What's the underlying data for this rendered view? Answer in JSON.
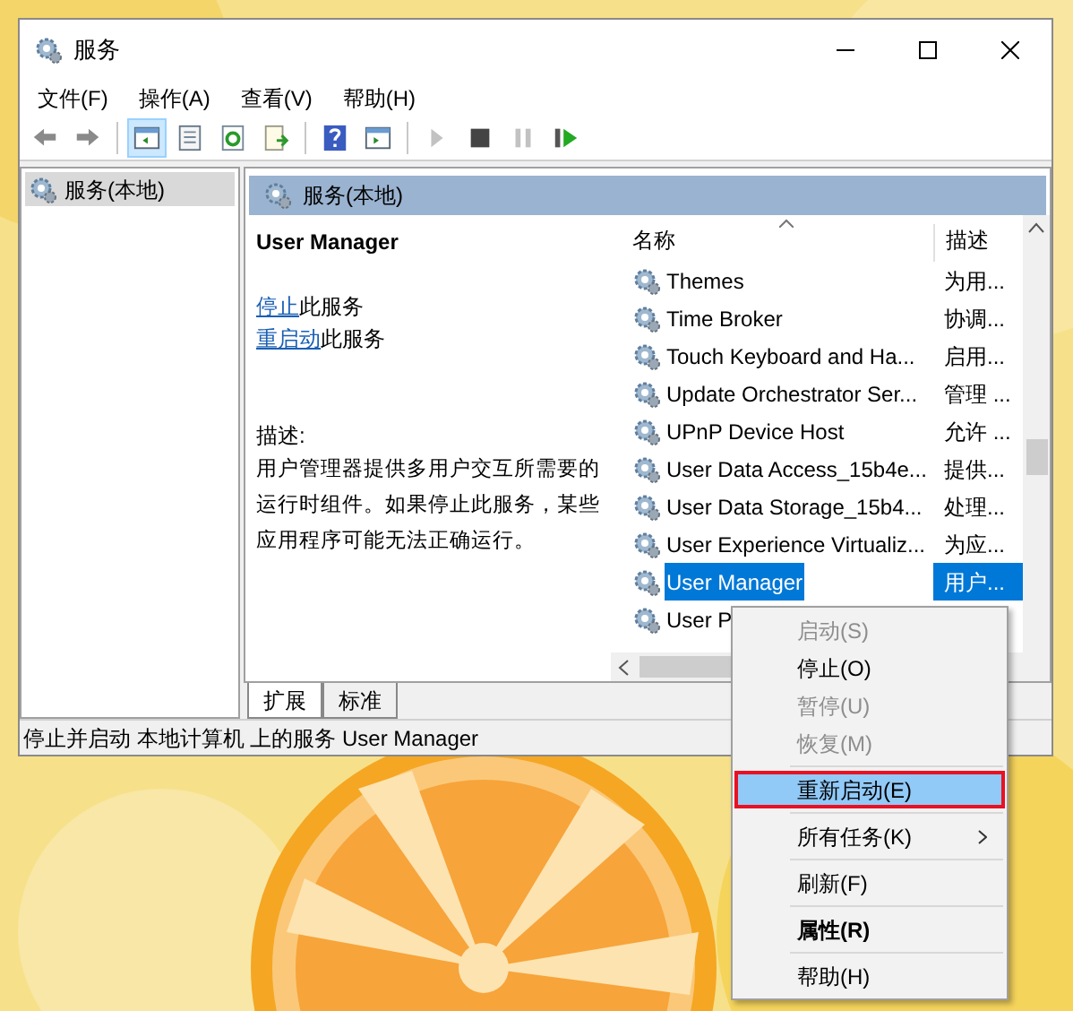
{
  "window": {
    "title": "服务"
  },
  "menu_bar": [
    "文件(F)",
    "操作(A)",
    "查看(V)",
    "帮助(H)"
  ],
  "toolbar": [
    {
      "disabled": false,
      "selected": false
    },
    {
      "disabled": false,
      "selected": false
    },
    {
      "disabled": false,
      "selected": true
    },
    {
      "disabled": false,
      "selected": false
    },
    {
      "disabled": false,
      "selected": false
    },
    {
      "disabled": false,
      "selected": false
    },
    {
      "disabled": false,
      "selected": false
    },
    {
      "disabled": false,
      "selected": false
    },
    {
      "disabled": true,
      "selected": false
    },
    {
      "disabled": false,
      "selected": false
    },
    {
      "disabled": true,
      "selected": false
    },
    {
      "disabled": false,
      "selected": false
    }
  ],
  "tree": {
    "items": [
      {
        "label": "服务(本地)",
        "selected": true
      }
    ]
  },
  "pane_header": "服务(本地)",
  "detail": {
    "title": "User Manager",
    "actions": [
      {
        "link": "停止",
        "rest": "此服务"
      },
      {
        "link": "重启动",
        "rest": "此服务"
      }
    ],
    "description_label": "描述:",
    "description": "用户管理器提供多用户交互所需要的运行时组件。如果停止此服务，某些应用程序可能无法正确运行。"
  },
  "table": {
    "columns": [
      "名称",
      "描述"
    ],
    "rows": [
      {
        "name": "Themes",
        "description": "为用...",
        "selected": false
      },
      {
        "name": "Time Broker",
        "description": "协调...",
        "selected": false
      },
      {
        "name": "Touch Keyboard and Ha...",
        "description": "启用...",
        "selected": false
      },
      {
        "name": "Update Orchestrator Ser...",
        "description": "管理 ...",
        "selected": false
      },
      {
        "name": "UPnP Device Host",
        "description": "允许 ...",
        "selected": false
      },
      {
        "name": "User Data Access_15b4e...",
        "description": "提供...",
        "selected": false
      },
      {
        "name": "User Data Storage_15b4...",
        "description": "处理...",
        "selected": false
      },
      {
        "name": "User Experience Virtualiz...",
        "description": "为应...",
        "selected": false
      },
      {
        "name": "User Manager",
        "description": "用户...",
        "selected": true
      },
      {
        "name": "User P",
        "selected": false
      }
    ]
  },
  "tabs": [
    {
      "label": "扩展",
      "selected": true
    },
    {
      "label": "标准",
      "selected": false
    }
  ],
  "status_bar": "停止并启动 本地计算机 上的服务 User Manager",
  "context_menu": [
    {
      "kind": "item",
      "label": "启动(S)",
      "disabled": true,
      "selected": false,
      "bold": false
    },
    {
      "kind": "item",
      "label": "停止(O)",
      "disabled": false,
      "selected": false,
      "bold": false
    },
    {
      "kind": "item",
      "label": "暂停(U)",
      "disabled": true,
      "selected": false,
      "bold": false
    },
    {
      "kind": "item",
      "label": "恢复(M)",
      "disabled": true,
      "selected": false,
      "bold": false
    },
    {
      "kind": "separator"
    },
    {
      "kind": "item",
      "label": "重新启动(E)",
      "disabled": false,
      "selected": true,
      "bold": false
    },
    {
      "kind": "separator"
    },
    {
      "kind": "submenu",
      "label": "所有任务(K)",
      "disabled": false,
      "selected": false,
      "bold": false
    },
    {
      "kind": "separator"
    },
    {
      "kind": "item",
      "label": "刷新(F)",
      "disabled": false,
      "selected": false,
      "bold": false
    },
    {
      "kind": "separator"
    },
    {
      "kind": "item",
      "label": "属性(R)",
      "disabled": false,
      "selected": false,
      "bold": true
    },
    {
      "kind": "separator"
    },
    {
      "kind": "item",
      "label": "帮助(H)",
      "disabled": false,
      "selected": false,
      "bold": false
    }
  ]
}
